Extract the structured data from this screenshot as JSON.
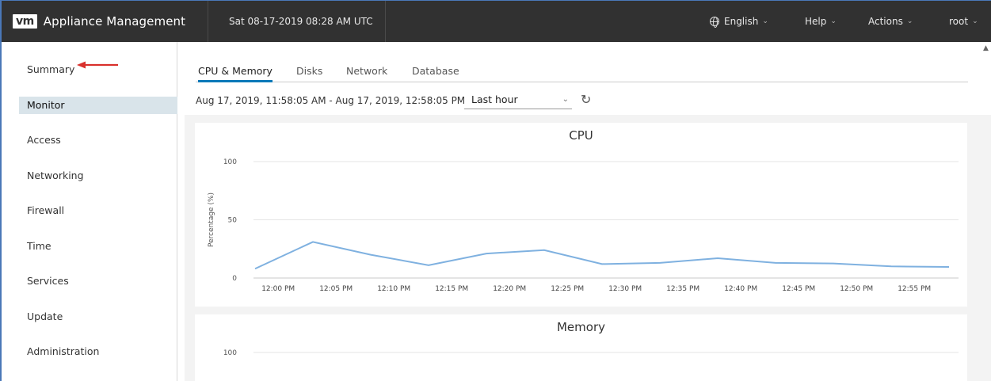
{
  "header": {
    "logo": "vm",
    "title": "Appliance Management",
    "datetime": "Sat 08-17-2019 08:28 AM UTC",
    "menus": [
      "English",
      "Help",
      "Actions",
      "root"
    ]
  },
  "sidebar": {
    "items": [
      {
        "label": "Summary"
      },
      {
        "label": "Monitor",
        "active": true
      },
      {
        "label": "Access"
      },
      {
        "label": "Networking"
      },
      {
        "label": "Firewall"
      },
      {
        "label": "Time"
      },
      {
        "label": "Services"
      },
      {
        "label": "Update"
      },
      {
        "label": "Administration"
      }
    ]
  },
  "tabs": [
    {
      "label": "CPU & Memory",
      "active": true
    },
    {
      "label": "Disks"
    },
    {
      "label": "Network"
    },
    {
      "label": "Database"
    }
  ],
  "time_range": {
    "text": "Aug 17, 2019, 11:58:05 AM - Aug 17, 2019, 12:58:05 PM",
    "period": "Last hour"
  },
  "colors": {
    "accent": "#0079b8",
    "line": "#7fb1e0",
    "header_bg": "#313131",
    "annotation_arrow": "#d9302c"
  },
  "chart_data": [
    {
      "type": "line",
      "title": "CPU",
      "ylabel": "Percentage (%)",
      "ylim": [
        0,
        100
      ],
      "yticks": [
        0,
        50,
        100
      ],
      "xticks": [
        "12:00 PM",
        "12:05 PM",
        "12:10 PM",
        "12:15 PM",
        "12:20 PM",
        "12:25 PM",
        "12:30 PM",
        "12:35 PM",
        "12:40 PM",
        "12:45 PM",
        "12:50 PM",
        "12:55 PM"
      ],
      "x": [
        "11:58 AM",
        "12:03 PM",
        "12:08 PM",
        "12:13 PM",
        "12:18 PM",
        "12:23 PM",
        "12:28 PM",
        "12:33 PM",
        "12:38 PM",
        "12:43 PM",
        "12:48 PM",
        "12:53 PM",
        "12:58 PM"
      ],
      "values": [
        8,
        31,
        20,
        11,
        21,
        24,
        12,
        13,
        17,
        13,
        12.5,
        10,
        9.5
      ],
      "grid": true
    },
    {
      "type": "line",
      "title": "Memory",
      "ylabel": "",
      "ylim": [
        0,
        100
      ],
      "yticks": [
        100
      ],
      "grid": true
    }
  ]
}
